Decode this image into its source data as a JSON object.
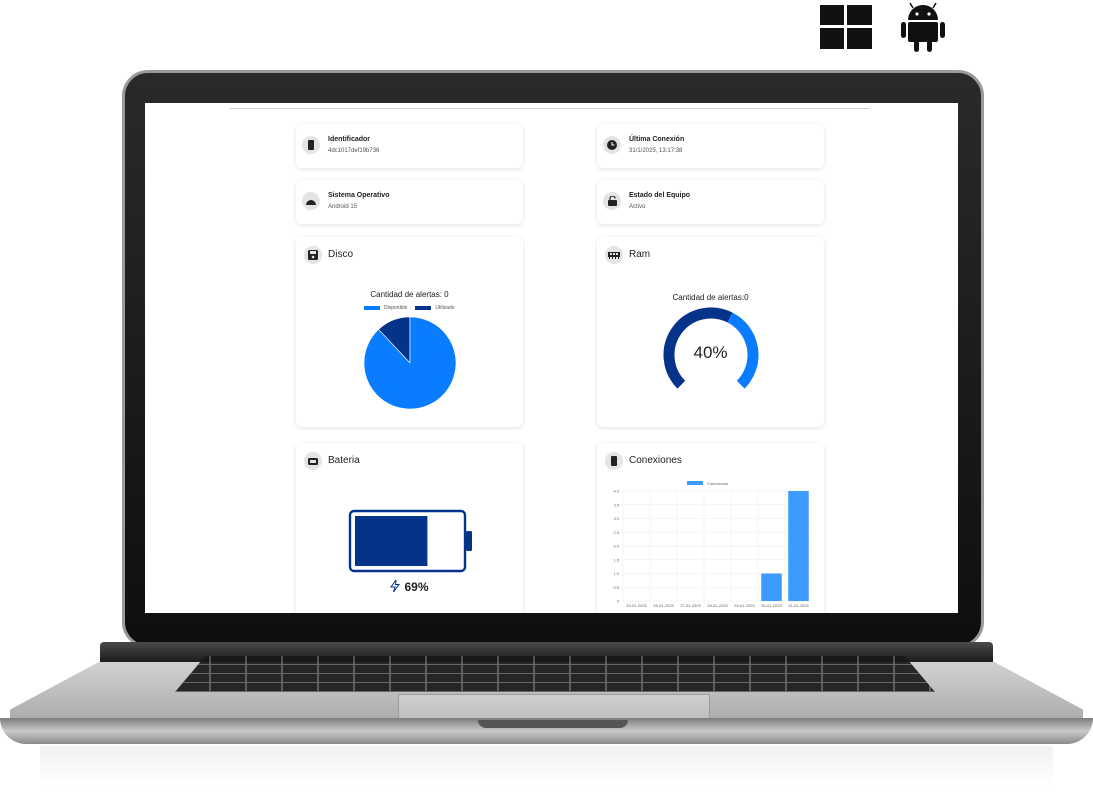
{
  "os_icons": [
    "windows-logo",
    "android-logo"
  ],
  "dashboard": {
    "info_cards": [
      {
        "title": "Identificador",
        "value": "4dc1017def19b736",
        "icon": "phone-icon"
      },
      {
        "title": "Última Conexión",
        "value": "31/1/2025, 13:17:38",
        "icon": "clock-icon"
      },
      {
        "title": "Sistema Operativo",
        "value": "Android 15",
        "icon": "android-icon"
      },
      {
        "title": "Estado del Equipo",
        "value": "Activo",
        "icon": "unlock-icon"
      }
    ],
    "disk": {
      "title": "Disco",
      "alert_text": "Cantidad de alertas: 0",
      "legend": [
        "Disponible",
        "Utilizado"
      ],
      "colors": {
        "available": "#0a7cff",
        "used": "#06338a"
      }
    },
    "ram": {
      "title": "Ram",
      "alert_text": "Cantidad de alertas:0",
      "percent_label": "40%",
      "colors": {
        "used": "#0a7cff",
        "free": "#06338a"
      }
    },
    "battery": {
      "title": "Bateria",
      "percent_label": "69%",
      "color": "#06338a"
    },
    "connections": {
      "title": "Conexiones",
      "legend": "Conexiones",
      "color": "#3d9bff"
    }
  },
  "chart_data": [
    {
      "type": "pie",
      "series": [
        {
          "name": "Disponible",
          "value": 88
        },
        {
          "name": "Utilizado",
          "value": 12
        }
      ]
    },
    {
      "type": "bar",
      "categories": [
        "25-01-2025",
        "26-01-2025",
        "27-01-2025",
        "28-01-2025",
        "29-01-2025",
        "30-01-2025",
        "31-01-2025"
      ],
      "series": [
        {
          "name": "Conexiones",
          "values": [
            0,
            0,
            0,
            0,
            0,
            1,
            4
          ]
        }
      ],
      "ylim": [
        0,
        4
      ],
      "yticks": [
        "4.0",
        "3.5",
        "3.0",
        "2.5",
        "2.0",
        "1.5",
        "1.0",
        "0.5",
        "0"
      ]
    }
  ],
  "ram_fraction": 0.4,
  "battery_fraction": 0.69
}
